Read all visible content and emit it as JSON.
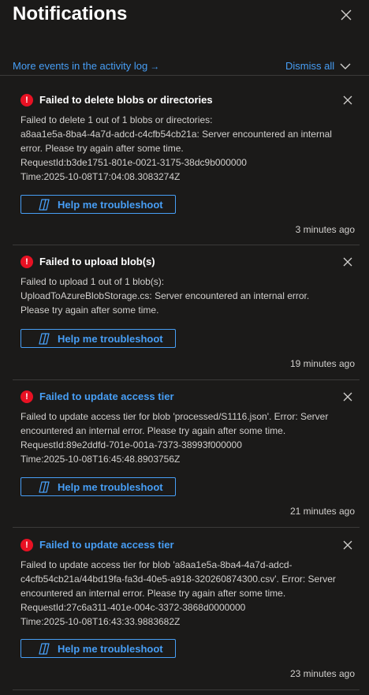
{
  "header": {
    "title": "Notifications"
  },
  "actions": {
    "activity_link": "More events in the activity log",
    "activity_arrow": "→",
    "dismiss_all": "Dismiss all"
  },
  "colors": {
    "accent": "#479ef5",
    "error": "#e81123",
    "background": "#1b1a19"
  },
  "icons": {
    "error": "error-circle-icon",
    "close": "close-icon",
    "troubleshoot": "copilot-icon",
    "chevron": "chevron-down-icon"
  },
  "notifications": [
    {
      "title": "Failed to delete blobs or directories",
      "lines": [
        "Failed to delete 1 out of 1 blobs or directories:",
        "a8aa1e5a-8ba4-4a7d-adcd-c4cfb54cb21a: Server encountered an internal",
        "error. Please try again after some time.",
        "RequestId:b3de1751-801e-0021-3175-38dc9b000000",
        "Time:2025-10-08T17:04:08.3083274Z"
      ],
      "button": "Help me troubleshoot",
      "time": "3 minutes ago"
    },
    {
      "title": "Failed to upload blob(s)",
      "lines": [
        "Failed to upload 1 out of 1 blob(s):",
        "UploadToAzureBlobStorage.cs: Server encountered an internal error.",
        "Please try again after some time."
      ],
      "button": "Help me troubleshoot",
      "time": "19 minutes ago"
    },
    {
      "title": "Failed to update access tier",
      "lines": [
        "Failed to update access tier for blob 'processed/S1116.json'. Error: Server",
        "encountered an internal error. Please try again after some time.",
        "RequestId:89e2ddfd-701e-001a-7373-38993f000000",
        "Time:2025-10-08T16:45:48.8903756Z"
      ],
      "button": "Help me troubleshoot",
      "time": "21 minutes ago"
    },
    {
      "title": "Failed to update access tier",
      "lines": [
        "Failed to update access tier for blob 'a8aa1e5a-8ba4-4a7d-adcd-",
        "c4cfb54cb21a/44bd19fa-fa3d-40e5-a918-320260874300.csv'. Error: Server",
        "encountered an internal error. Please try again after some time.",
        "RequestId:27c6a311-401e-004c-3372-3868d0000000",
        "Time:2025-10-08T16:43:33.9883682Z"
      ],
      "button": "Help me troubleshoot",
      "time": "23 minutes ago"
    }
  ]
}
